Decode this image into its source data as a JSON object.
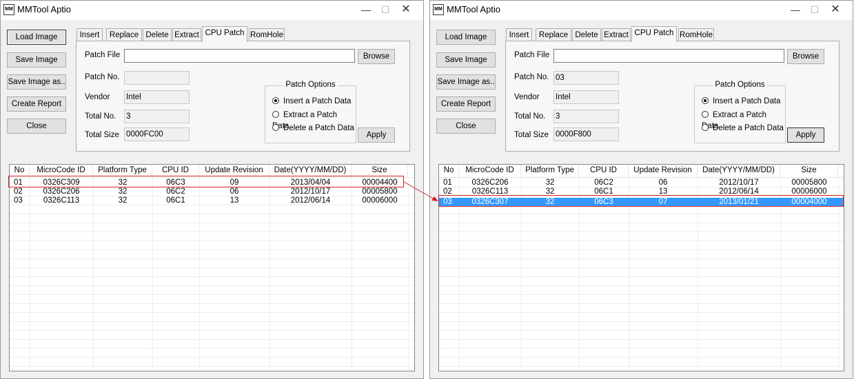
{
  "app": {
    "title": "MMTool Aptio",
    "icon_text": "MM"
  },
  "titlebar": {
    "minimize": "—",
    "maximize": "☐",
    "close": "✕"
  },
  "buttons": {
    "load_image": "Load Image",
    "save_image": "Save Image",
    "save_image_as": "Save Image as..",
    "create_report": "Create Report",
    "close": "Close"
  },
  "tabs": [
    "Insert",
    "Replace",
    "Delete",
    "Extract",
    "CPU Patch",
    "RomHole"
  ],
  "form": {
    "patch_file_label": "Patch File",
    "patch_no_label": "Patch No.",
    "vendor_label": "Vendor",
    "total_no_label": "Total No.",
    "total_size_label": "Total Size",
    "browse": "Browse",
    "apply": "Apply"
  },
  "patch_options": {
    "title": "Patch Options",
    "insert": "Insert a Patch Data",
    "extract": "Extract a Patch Data",
    "delete": "Delete a Patch Data"
  },
  "columns": [
    "No",
    "MicroCode ID",
    "Platform Type",
    "CPU ID",
    "Update Revision",
    "Date(YYYY/MM/DD)",
    "Size"
  ],
  "left": {
    "patch_file": "",
    "patch_no": "",
    "vendor": "Intel",
    "total_no": "3",
    "total_size": "0000FC00",
    "rows": [
      [
        "01",
        "0326C309",
        "32",
        "06C3",
        "09",
        "2013/04/04",
        "00004400"
      ],
      [
        "02",
        "0326C206",
        "32",
        "06C2",
        "06",
        "2012/10/17",
        "00005800"
      ],
      [
        "03",
        "0326C113",
        "32",
        "06C1",
        "13",
        "2012/06/14",
        "00006000"
      ]
    ]
  },
  "right": {
    "patch_file": "",
    "patch_no": "03",
    "vendor": "Intel",
    "total_no": "3",
    "total_size": "0000F800",
    "rows": [
      [
        "01",
        "0326C206",
        "32",
        "06C2",
        "06",
        "2012/10/17",
        "00005800"
      ],
      [
        "02",
        "0326C113",
        "32",
        "06C1",
        "13",
        "2012/06/14",
        "00006000"
      ],
      [
        "03",
        "0326C307",
        "32",
        "06C3",
        "07",
        "2013/01/21",
        "00004000"
      ]
    ]
  },
  "colors": {
    "selection": "#3399ff",
    "highlight_box": "#d62222"
  }
}
